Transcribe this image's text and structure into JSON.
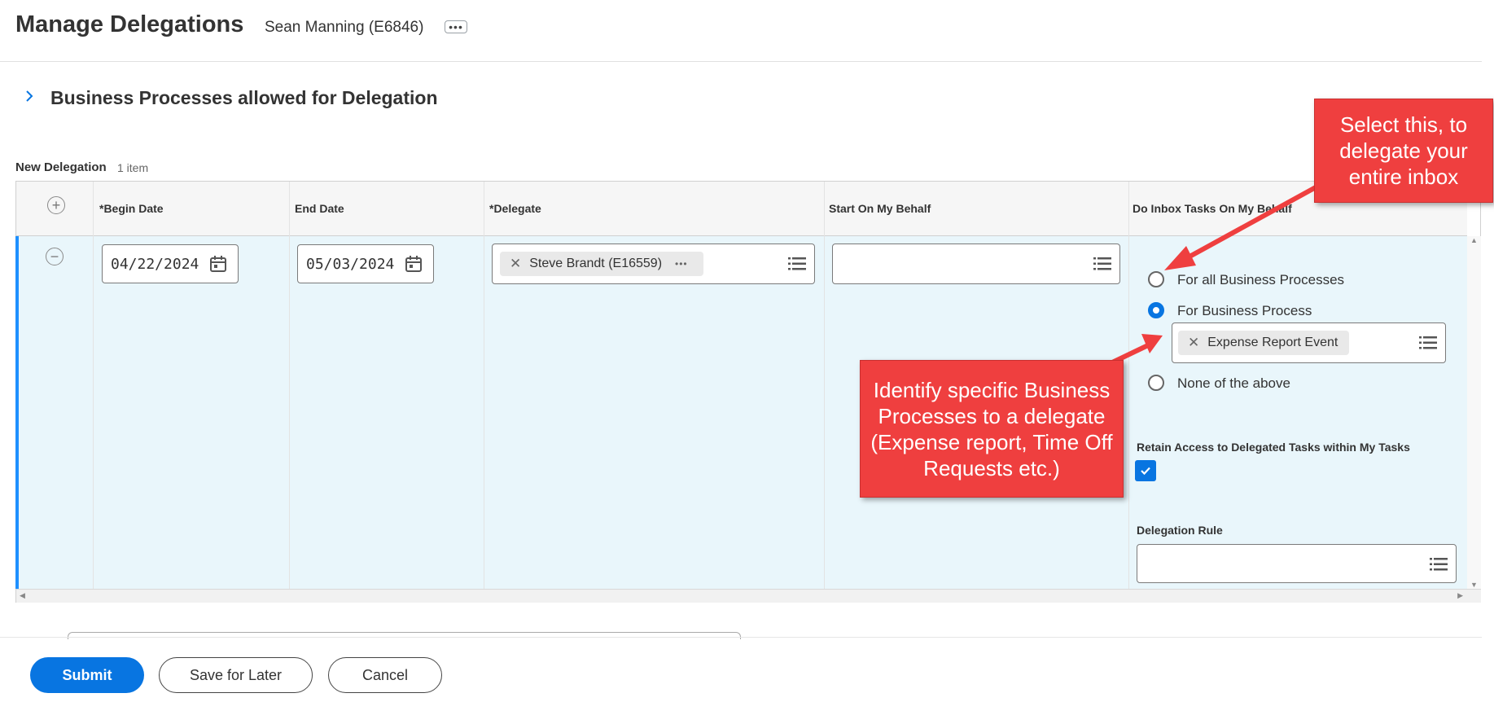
{
  "header": {
    "title": "Manage Delegations",
    "worker": "Sean Manning (E6846)",
    "more_label": "•••"
  },
  "section": {
    "title": "Business Processes allowed for Delegation"
  },
  "grid": {
    "label": "New Delegation",
    "count": "1 item",
    "columns": [
      "*Begin Date",
      "End Date",
      "*Delegate",
      "Start On My Behalf",
      "Do Inbox Tasks On My Behalf"
    ]
  },
  "row": {
    "begin_date": "04/22/2024",
    "end_date": "05/03/2024",
    "delegate": "Steve Brandt (E16559)",
    "delegate_more": "•••",
    "inbox_options": [
      {
        "label": "For all Business Processes",
        "selected": false
      },
      {
        "label": "For Business Process",
        "selected": true
      },
      {
        "label": "None of the above",
        "selected": false
      }
    ],
    "business_process": "Expense Report Event",
    "retain_access_label": "Retain Access to Delegated Tasks within My Tasks",
    "retain_access_checked": true,
    "delegation_rule_label": "Delegation Rule"
  },
  "footer": {
    "submit": "Submit",
    "save_later": "Save for Later",
    "cancel": "Cancel"
  },
  "callouts": {
    "inbox": "Select this, to delegate your entire inbox",
    "specific": "Identify specific Business Processes to a delegate (Expense report, Time Off Requests etc.)"
  },
  "colors": {
    "accent": "#0875e1",
    "row_background": "#e9f6fb",
    "callout": "#ef3f3f"
  }
}
